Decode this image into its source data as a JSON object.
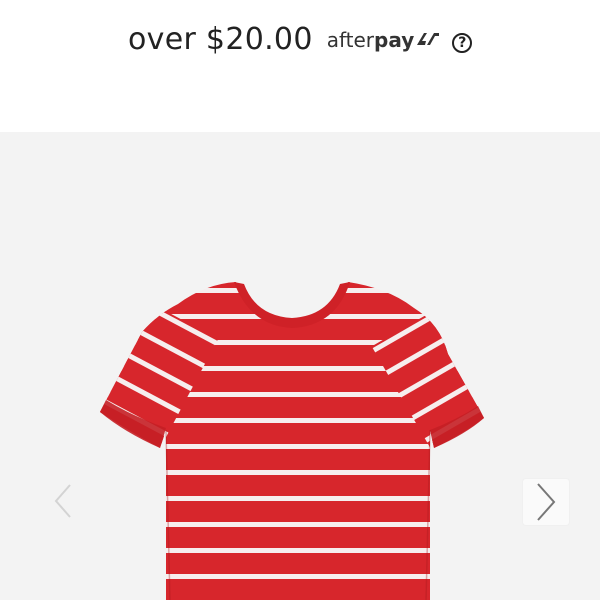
{
  "afterpay": {
    "text": "over $20.00",
    "brand_after": "after",
    "brand_pay": "pay",
    "help_symbol": "?"
  },
  "gallery": {
    "image_icon": "striped-tshirt",
    "next_icon": "chevron-right-icon",
    "prev_icon": "chevron-left-icon"
  },
  "colors": {
    "shirt_red": "#d7262c",
    "stripe_white": "#f6eeee",
    "background": "#f3f3f3",
    "text": "#222222"
  }
}
